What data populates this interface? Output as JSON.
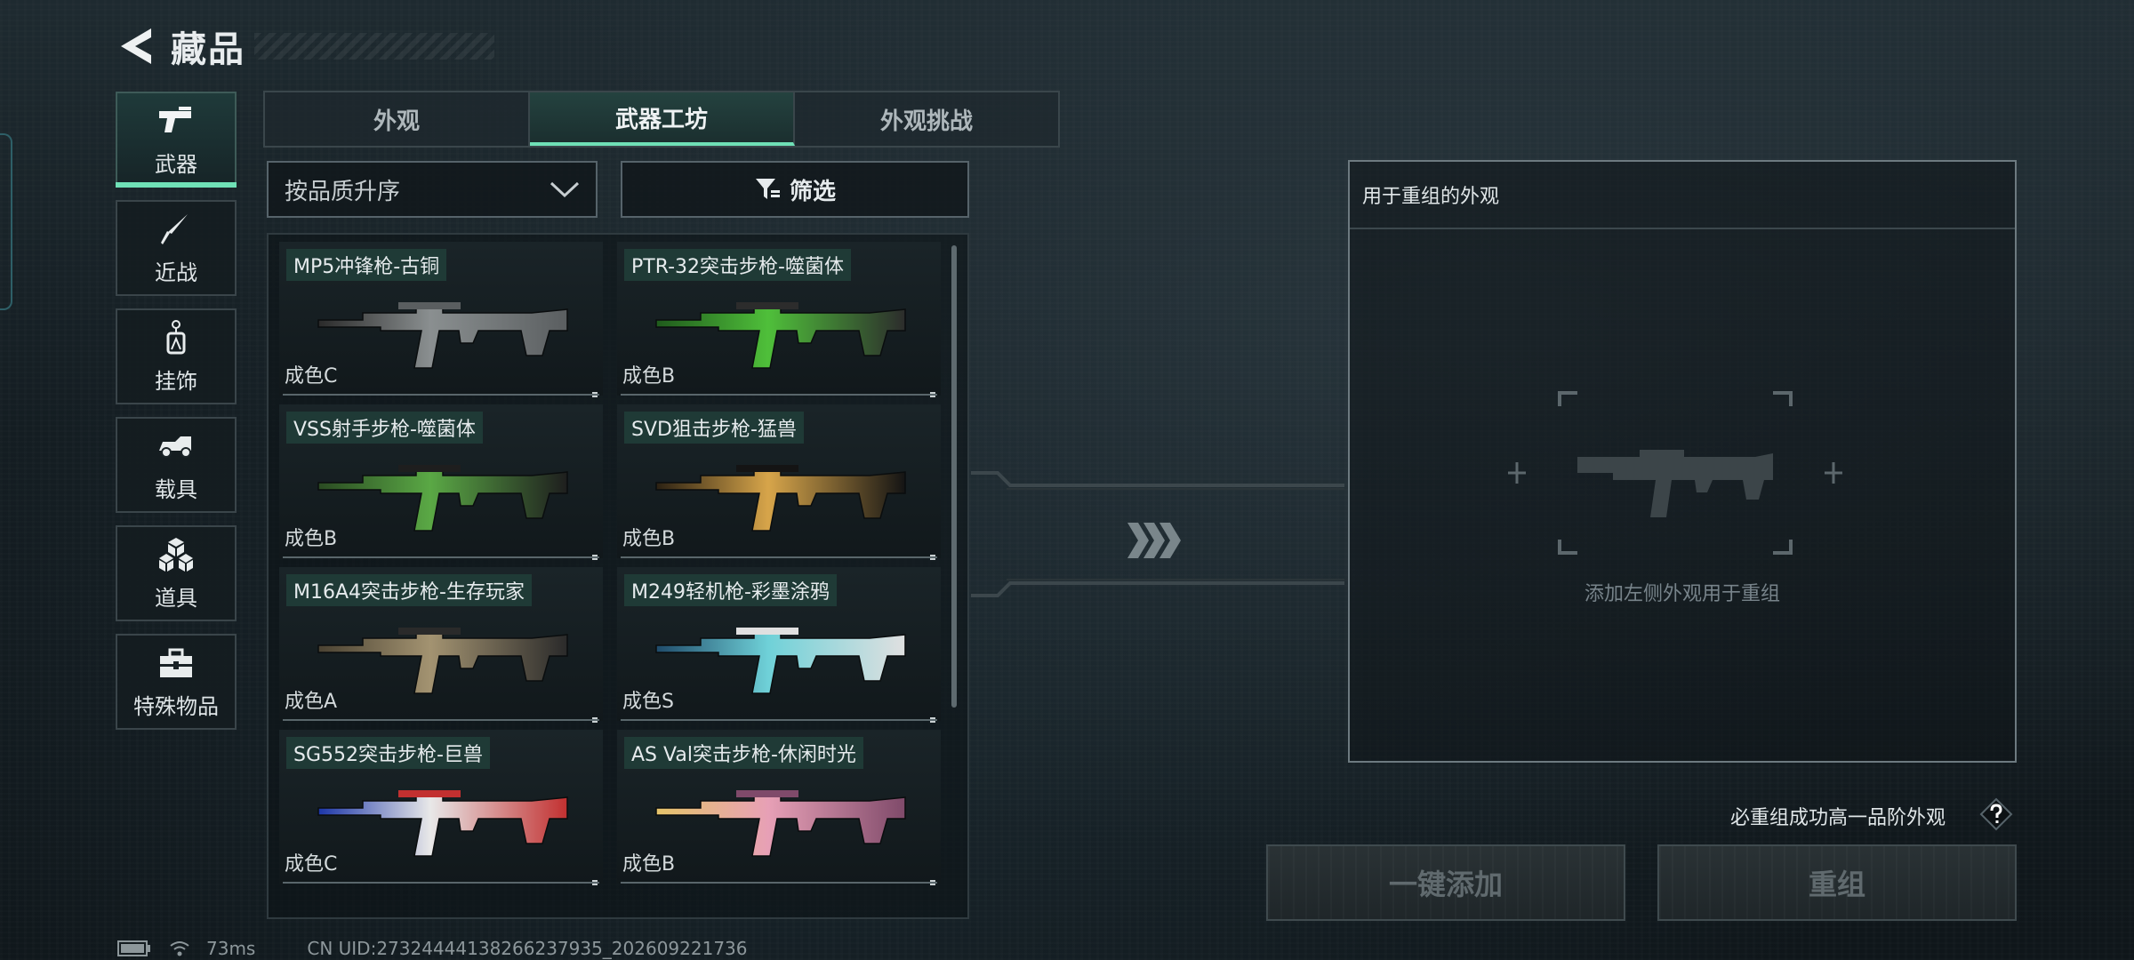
{
  "header": {
    "title": "藏品",
    "back_icon": "back-arrow-icon"
  },
  "categories": [
    {
      "label": "武器",
      "icon": "pistol-icon",
      "active": true
    },
    {
      "label": "近战",
      "icon": "knife-icon",
      "active": false
    },
    {
      "label": "挂饰",
      "icon": "charm-icon",
      "active": false
    },
    {
      "label": "载具",
      "icon": "vehicle-icon",
      "active": false
    },
    {
      "label": "道具",
      "icon": "cubes-icon",
      "active": false
    },
    {
      "label": "特殊物品",
      "icon": "toolbox-icon",
      "active": false
    }
  ],
  "tabs": [
    {
      "label": "外观",
      "active": false
    },
    {
      "label": "武器工坊",
      "active": true
    },
    {
      "label": "外观挑战",
      "active": false
    }
  ],
  "sort": {
    "label": "按品质升序"
  },
  "filter": {
    "label": "筛选"
  },
  "items": [
    {
      "name": "MP5冲锋枪-古铜",
      "grade": "成色C",
      "skin": [
        "#2a2a2a",
        "#8a8f90",
        "#5a5e60"
      ]
    },
    {
      "name": "PTR-32突击步枪-噬菌体",
      "grade": "成色B",
      "skin": [
        "#1f5a1c",
        "#4fbf3a",
        "#2c2c2c"
      ]
    },
    {
      "name": "VSS射手步枪-噬菌体",
      "grade": "成色B",
      "skin": [
        "#2a4a22",
        "#5aa845",
        "#1e1e1e"
      ]
    },
    {
      "name": "SVD狙击步枪-猛兽",
      "grade": "成色B",
      "skin": [
        "#2b2113",
        "#d7a54a",
        "#141414"
      ]
    },
    {
      "name": "M16A4突击步枪-生存玩家",
      "grade": "成色A",
      "skin": [
        "#4a4232",
        "#a39371",
        "#2a2a2a"
      ]
    },
    {
      "name": "M249轻机枪-彩墨涂鸦",
      "grade": "成色S",
      "skin": [
        "#1f4b6a",
        "#6fd1d8",
        "#e0e0e0"
      ]
    },
    {
      "name": "SG552突击步枪-巨兽",
      "grade": "成色C",
      "skin": [
        "#1c36a8",
        "#e8e8e8",
        "#c23030"
      ]
    },
    {
      "name": "AS Val突击步枪-休闲时光",
      "grade": "成色B",
      "skin": [
        "#e6c46a",
        "#e7a0b6",
        "#7f4a6a"
      ]
    }
  ],
  "recombine": {
    "header": "用于重组的外观",
    "hint": "添加左侧外观用于重组",
    "rule": "必重组成功高一品阶外观",
    "help_icon": "question-icon"
  },
  "actions": {
    "add_all": "一键添加",
    "recombine": "重组"
  },
  "status": {
    "ping": "73ms",
    "uid": "CN UID:27324444138266237935_202609221736"
  },
  "colors": {
    "accent": "#6fe0b6",
    "panel_border": "#6d7a80",
    "disabled_text": "#606a6e"
  }
}
